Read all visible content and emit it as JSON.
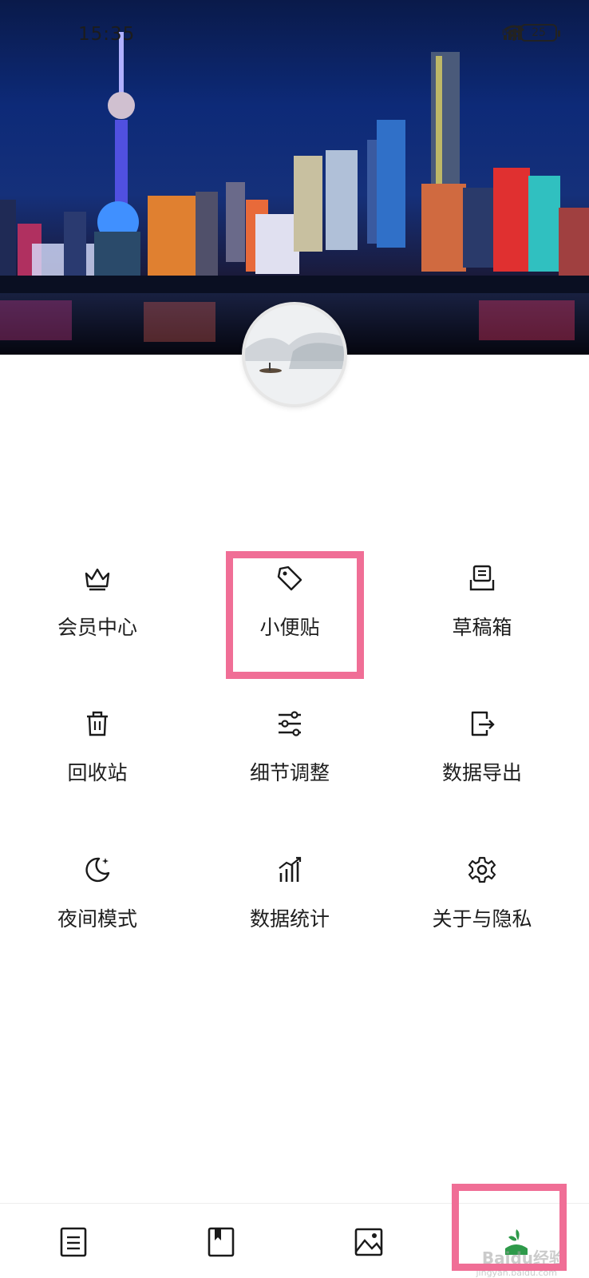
{
  "status_bar": {
    "time": "15:35",
    "network": "HD",
    "battery": "25"
  },
  "menu": [
    {
      "label": "会员中心",
      "icon": "crown-icon"
    },
    {
      "label": "小便贴",
      "icon": "tag-icon"
    },
    {
      "label": "草稿箱",
      "icon": "draft-box-icon"
    },
    {
      "label": "回收站",
      "icon": "trash-icon"
    },
    {
      "label": "细节调整",
      "icon": "sliders-icon"
    },
    {
      "label": "数据导出",
      "icon": "export-icon"
    },
    {
      "label": "夜间模式",
      "icon": "moon-icon"
    },
    {
      "label": "数据统计",
      "icon": "chart-icon"
    },
    {
      "label": "关于与隐私",
      "icon": "gear-icon"
    }
  ],
  "bottom_nav": [
    {
      "icon": "notes-icon"
    },
    {
      "icon": "bookmark-icon"
    },
    {
      "icon": "image-icon"
    },
    {
      "icon": "profile-icon",
      "active": true
    }
  ],
  "watermark": {
    "brand": "Baidu经验",
    "url": "jingyan.baidu.com"
  },
  "colors": {
    "highlight": "#f06e96",
    "active_nav": "#2e9a4a",
    "text": "#1e1e1e"
  }
}
